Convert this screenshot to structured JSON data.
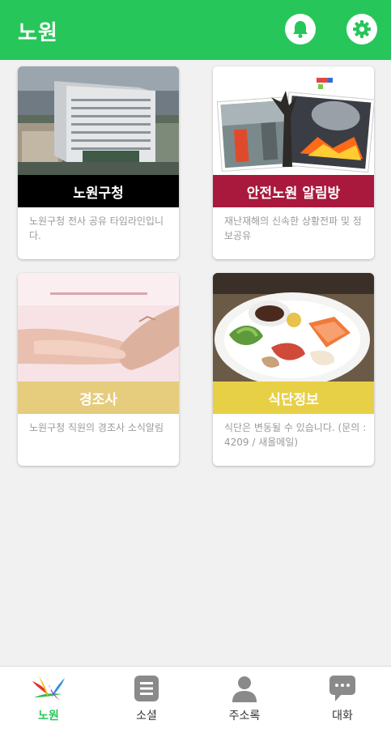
{
  "header": {
    "title": "노원",
    "bell_icon": "bell-icon",
    "settings_icon": "gear-icon"
  },
  "colors": {
    "brand": "#27c65a",
    "band_black": "#000000",
    "band_red": "#a8193d",
    "band_beige": "#e6cc7d",
    "band_yellow": "#e8d046"
  },
  "cards": [
    {
      "title": "노원구청",
      "desc": "노원구청 전사 공유 타임라인입니다."
    },
    {
      "title": "안전노원 알림방",
      "desc": "재난재해의 신속한 상황전파 및 정보공유"
    },
    {
      "title": "경조사",
      "desc": "노원구청 직원의 경조사 소식알림"
    },
    {
      "title": "식단정보",
      "desc": "식단은 변동될 수 있습니다. (문의 : 4209 / 새올메일)"
    }
  ],
  "nav": [
    {
      "label": "노원",
      "icon": "nowon-logo-icon",
      "active": true
    },
    {
      "label": "소셜",
      "icon": "document-icon",
      "active": false
    },
    {
      "label": "주소록",
      "icon": "person-icon",
      "active": false
    },
    {
      "label": "대화",
      "icon": "chat-bubble-icon",
      "active": false
    }
  ]
}
